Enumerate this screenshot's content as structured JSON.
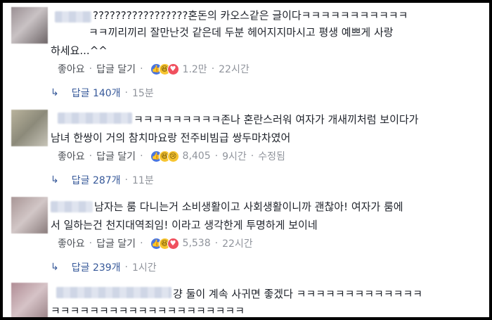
{
  "actions": {
    "like": "좋아요",
    "reply": "답글 달기",
    "edited": "수정됨"
  },
  "comments": [
    {
      "line1": "?????????????????혼돈의 카오스같은 글이다ㅋㅋㅋㅋㅋㅋㅋㅋㅋㅋㅋ",
      "line2": "ㅋㅋ끼리끼리 잘만난것 같은데 두분 헤어지지마시고 평생 예쁘게 사랑",
      "line3": "하세요...^^",
      "reactions": "1.2만",
      "time": "22시간",
      "reply_label": "답글 140개",
      "reply_time": "15분"
    },
    {
      "line1": "ㅋㅋㅋㅋㅋㅋㅋㅋㅋ존나 혼란스러워 여자가 개새끼처럼 보이다가",
      "line2": "남녀 한쌍이 거의 참치마요랑 전주비빔급 쌍두마차였어",
      "reactions": "8,405",
      "time": "9시간",
      "reply_label": "답글 287개",
      "reply_time": "11분"
    },
    {
      "line1": "남자는 룸 다니는거 소비생활이고 사회생활이니까 괜찮아! 여자가 룸에",
      "line2": "서 일하는건 천지대역죄임! 이라고 생각한게 투명하게 보이네",
      "reactions": "5,538",
      "time": "22시간",
      "reply_label": "답글 239개",
      "reply_time": "1시간"
    },
    {
      "line1": "걍 둘이 계속 사귀면 좋겠다 ㅋㅋㅋㅋㅋㅋㅋㅋㅋㅋㅋㅋㅋ",
      "line2": "ㅋㅋㅋㅋㅋㅋㅋㅋㅋㅋㅋㅋㅋㅋㅋㅋㅋㅋㅋㅋ"
    }
  ]
}
